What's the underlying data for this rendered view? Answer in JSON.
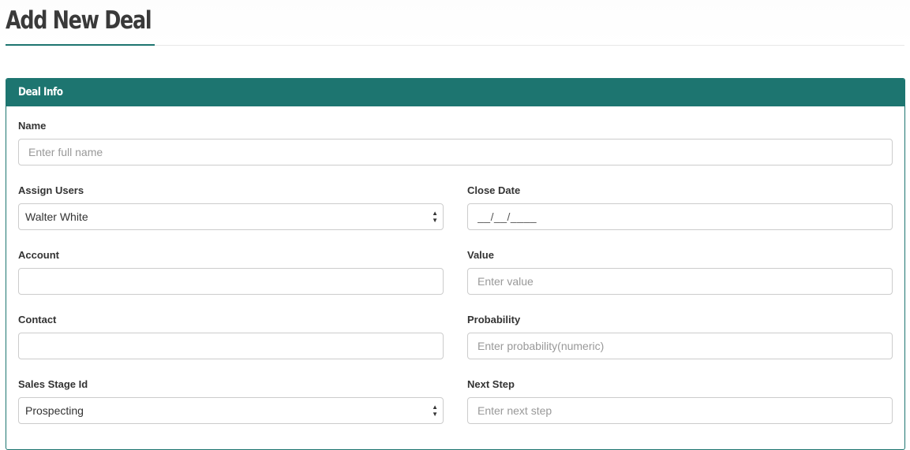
{
  "page": {
    "title": "Add New Deal"
  },
  "panel": {
    "title": "Deal Info"
  },
  "form": {
    "name": {
      "label": "Name",
      "placeholder": "Enter full name"
    },
    "assign_users": {
      "label": "Assign Users",
      "selected": "Walter White"
    },
    "close_date": {
      "label": "Close Date",
      "value": "__/__/____"
    },
    "account": {
      "label": "Account",
      "value": ""
    },
    "value": {
      "label": "Value",
      "placeholder": "Enter value"
    },
    "contact": {
      "label": "Contact",
      "value": ""
    },
    "probability": {
      "label": "Probability",
      "placeholder": "Enter probability(numeric)"
    },
    "sales_stage": {
      "label": "Sales Stage Id",
      "selected": "Prospecting"
    },
    "next_step": {
      "label": "Next Step",
      "placeholder": "Enter next step"
    }
  },
  "colors": {
    "accent": "#1d7570",
    "input_border": "#cccccc",
    "placeholder": "#999999"
  },
  "icons": {
    "select_arrows": "up-down-arrows-icon"
  }
}
